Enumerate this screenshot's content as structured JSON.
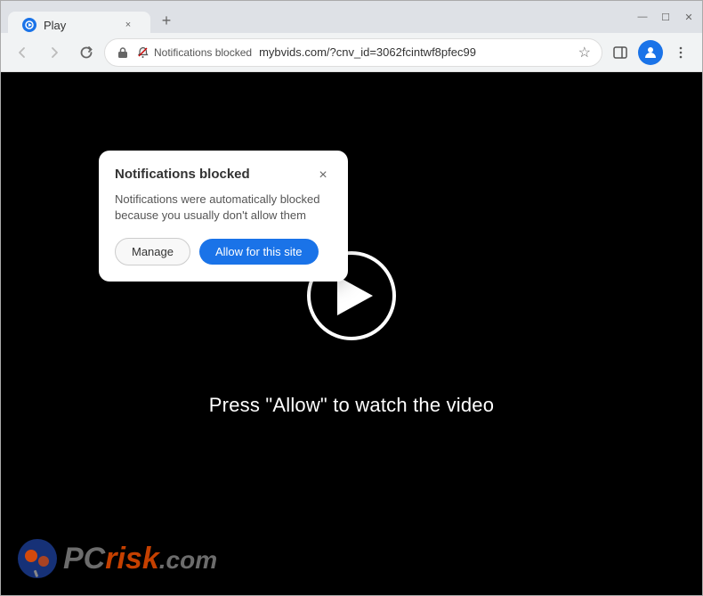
{
  "browser": {
    "tab": {
      "favicon_label": "Play",
      "title": "Play",
      "close_label": "×"
    },
    "new_tab_label": "+",
    "window_controls": {
      "minimize": "—",
      "maximize": "☐",
      "close": "✕"
    },
    "nav": {
      "back_label": "←",
      "forward_label": "→",
      "reload_label": "↻",
      "notifications_blocked": "Notifications blocked",
      "url": "mybvids.com/?cnv_id=3062fcintwf8pfec99",
      "bookmark_label": "☆"
    }
  },
  "notification_popup": {
    "title": "Notifications blocked",
    "body": "Notifications were automatically blocked because you usually don't allow them",
    "close_label": "×",
    "manage_label": "Manage",
    "allow_label": "Allow for this site"
  },
  "page": {
    "video_prompt": "Press \"Allow\" to watch the video"
  },
  "watermark": {
    "text_pc": "PC",
    "text_risk": "risk",
    "text_com": ".com"
  }
}
